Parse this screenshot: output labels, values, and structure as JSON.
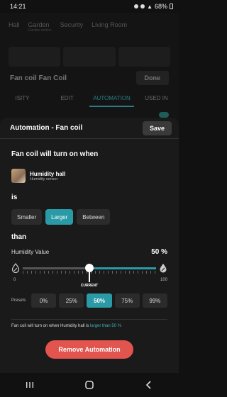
{
  "status_bar": {
    "time": "14:21",
    "battery": "68%"
  },
  "background": {
    "tabs": [
      {
        "label": "Hall",
        "sub": ""
      },
      {
        "label": "Garden",
        "sub": "Garden motion"
      },
      {
        "label": "Security",
        "sub": ""
      },
      {
        "label": "Living Room",
        "sub": ""
      }
    ],
    "title": "Fan coil Fan Coil",
    "done_label": "Done",
    "subtabs": [
      "ISITY",
      "EDIT",
      "AUTOMATION",
      "USED IN"
    ],
    "active_subtab": "AUTOMATION"
  },
  "sheet": {
    "title": "Automation - Fan coil",
    "save_label": "Save",
    "when_text": "Fan coil will turn on when",
    "device": {
      "name": "Humidity hall",
      "type": "Humidity sensor"
    },
    "is_label": "is",
    "comparators": [
      "Smaller",
      "Larger",
      "Between"
    ],
    "selected_comparator": "Larger",
    "than_label": "than",
    "value_label": "Humidity Value",
    "value_display": "50 %",
    "slider": {
      "min_label": "0",
      "max_label": "100",
      "value": 50,
      "current_label": "CURRENT"
    },
    "presets_label": "Presets",
    "presets": [
      "0%",
      "25%",
      "50%",
      "75%",
      "99%"
    ],
    "selected_preset": "50%",
    "summary": {
      "prefix": "Fan coil will turn on when Humidity hall is ",
      "highlight": "larger than 50 %"
    },
    "remove_label": "Remove Automation"
  },
  "colors": {
    "accent": "#2a9aa6",
    "danger": "#e2544e"
  }
}
